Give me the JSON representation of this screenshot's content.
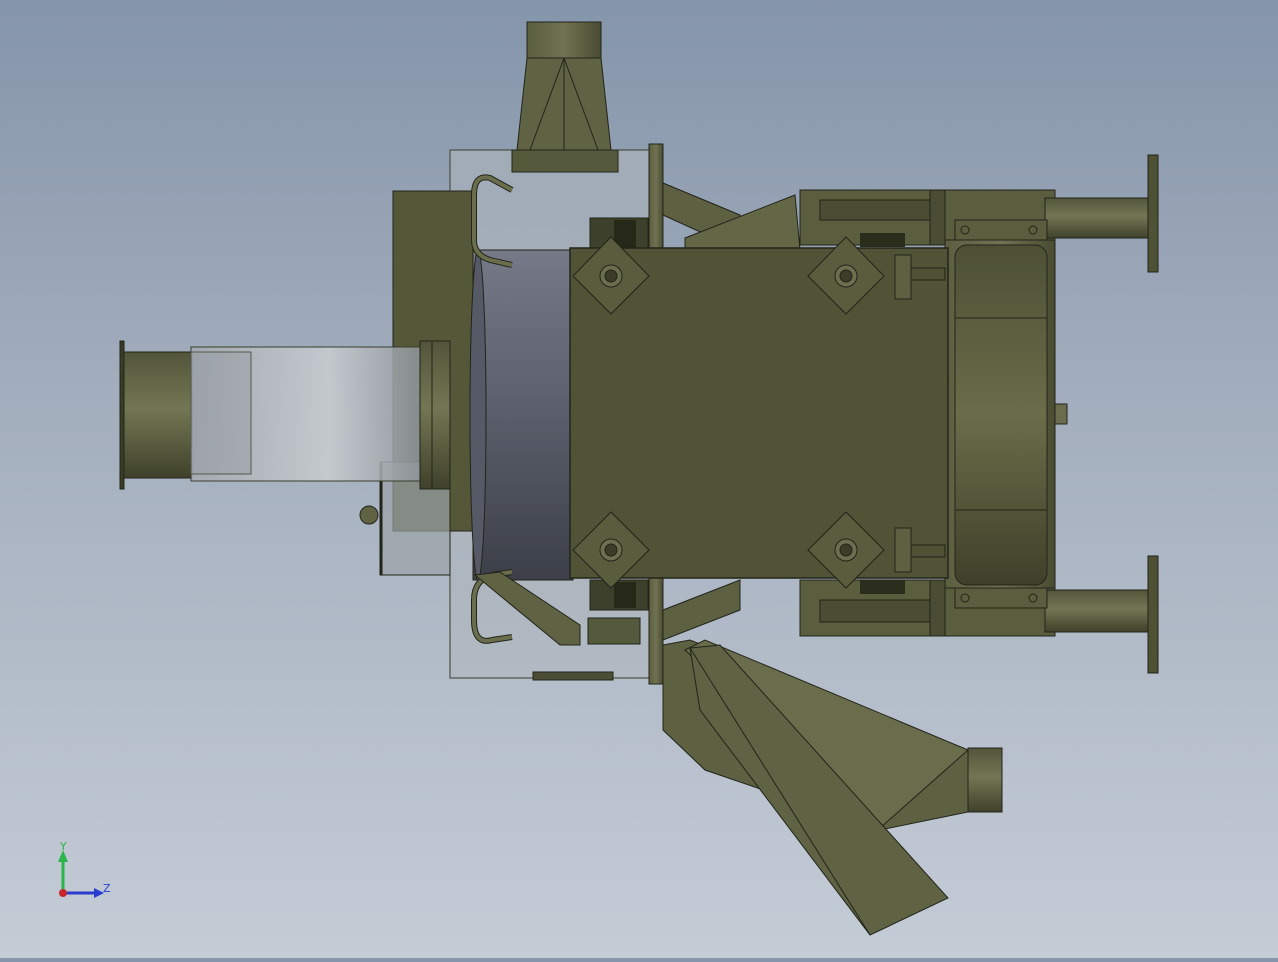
{
  "viewport": {
    "background_top": "#8595aa",
    "background_bottom": "#c4ccd6",
    "model_color": "#565a3d",
    "model_light": "#6c6e4c",
    "model_dark": "#3a3c26",
    "edge_color": "#22241a",
    "glass_color": "#b9c0c8"
  },
  "triad": {
    "y_label": "Y",
    "z_label": "Z",
    "y_color": "#2bb54a",
    "z_color": "#2a3ccf",
    "x_color": "#c8262b"
  }
}
